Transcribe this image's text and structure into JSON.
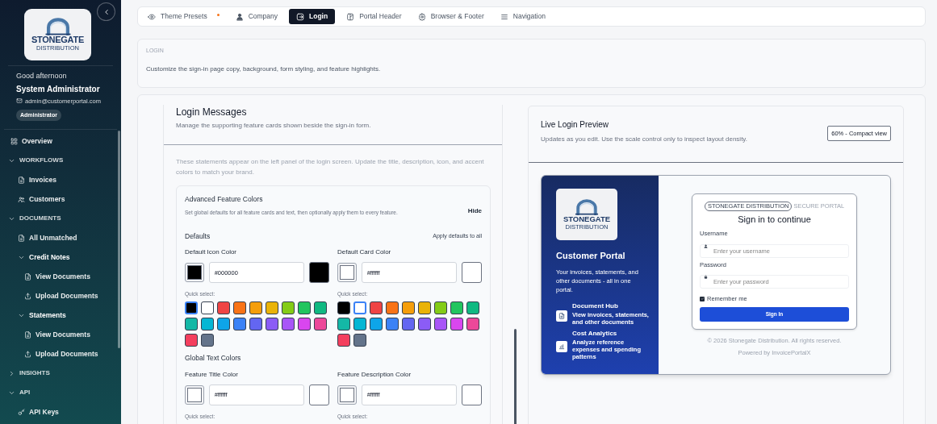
{
  "sidebar": {
    "logo": {
      "name": "STONEGATE",
      "tagline": "DISTRIBUTION"
    },
    "greeting": "Good afternoon",
    "user_name": "System Administrator",
    "email": "admin@customerportal.com",
    "role": "Administrator",
    "nav": [
      {
        "kind": "overview",
        "label": "Overview"
      },
      {
        "kind": "section",
        "label": "WORKFLOWS",
        "expanded": true,
        "children": [
          {
            "kind": "document",
            "label": "Invoices"
          },
          {
            "kind": "customers",
            "label": "Customers"
          }
        ]
      },
      {
        "kind": "section",
        "label": "DOCUMENTS",
        "expanded": true,
        "children": [
          {
            "kind": "document",
            "label": "All Unmatched"
          },
          {
            "kind": "group",
            "label": "Credit Notes",
            "expanded": true,
            "children": [
              {
                "kind": "document",
                "label": "View Documents"
              },
              {
                "kind": "upload",
                "label": "Upload Documents"
              }
            ]
          },
          {
            "kind": "group",
            "label": "Statements",
            "expanded": true,
            "children": [
              {
                "kind": "document",
                "label": "View Documents"
              },
              {
                "kind": "upload",
                "label": "Upload Documents"
              }
            ]
          }
        ]
      },
      {
        "kind": "section",
        "label": "INSIGHTS",
        "expanded": false
      },
      {
        "kind": "section",
        "label": "API",
        "expanded": true,
        "children": [
          {
            "kind": "api-key",
            "label": "API Keys"
          }
        ]
      }
    ]
  },
  "tabs": [
    {
      "label": "Theme Presets",
      "selected": false,
      "modified": true
    },
    {
      "label": "Company",
      "selected": false,
      "modified": false
    },
    {
      "label": "Login",
      "selected": true,
      "modified": false
    },
    {
      "label": "Portal Header",
      "selected": false,
      "modified": false
    },
    {
      "label": "Browser & Footer",
      "selected": false,
      "modified": false
    },
    {
      "label": "Navigation",
      "selected": false,
      "modified": false
    }
  ],
  "section": {
    "eyebrow": "LOGIN",
    "description": "Customize the sign-in page copy, background, form styling, and feature highlights."
  },
  "editor": {
    "title": "Login Messages",
    "subtitle": "Manage the supporting feature cards shown beside the sign-in form.",
    "info": "These statements appear on the left panel of the login screen. Update the title, description, icon, and accent colors to match your brand.",
    "advanced": {
      "title": "Advanced Feature Colors",
      "description": "Set global defaults for all feature cards and text, then optionally apply them to every feature.",
      "toggle": "Hide",
      "groups": [
        {
          "title": "Defaults",
          "action": "Apply defaults to all",
          "fields": [
            {
              "label": "Default Icon Color",
              "value": "#000000",
              "color": "#000000",
              "quick_label": "Quick select:",
              "swatches": [
                {
                  "color": "#000000",
                  "selected": true
                },
                {
                  "color": "#ffffff",
                  "selected": false
                },
                {
                  "color": "#ef4444",
                  "selected": false
                },
                {
                  "color": "#f97316",
                  "selected": false
                },
                {
                  "color": "#f59e0b",
                  "selected": false
                },
                {
                  "color": "#eab308",
                  "selected": false
                },
                {
                  "color": "#84cc16",
                  "selected": false
                },
                {
                  "color": "#22c55e",
                  "selected": false
                },
                {
                  "color": "#10b981",
                  "selected": false
                },
                {
                  "color": "#14b8a6",
                  "selected": false
                },
                {
                  "color": "#06b6d4",
                  "selected": false
                },
                {
                  "color": "#0ea5e9",
                  "selected": false
                },
                {
                  "color": "#3b82f6",
                  "selected": false
                },
                {
                  "color": "#6366f1",
                  "selected": false
                },
                {
                  "color": "#8b5cf6",
                  "selected": false
                },
                {
                  "color": "#a855f7",
                  "selected": false
                },
                {
                  "color": "#d946ef",
                  "selected": false
                },
                {
                  "color": "#ec4899",
                  "selected": false
                },
                {
                  "color": "#f43f5e",
                  "selected": false
                },
                {
                  "color": "#64748b",
                  "selected": false
                }
              ]
            },
            {
              "label": "Default Card Color",
              "value": "#ffffff",
              "color": "#ffffff",
              "quick_label": "Quick select:",
              "swatches": [
                {
                  "color": "#000000",
                  "selected": false
                },
                {
                  "color": "#ffffff",
                  "selected": true
                },
                {
                  "color": "#ef4444",
                  "selected": false
                },
                {
                  "color": "#f97316",
                  "selected": false
                },
                {
                  "color": "#f59e0b",
                  "selected": false
                },
                {
                  "color": "#eab308",
                  "selected": false
                },
                {
                  "color": "#84cc16",
                  "selected": false
                },
                {
                  "color": "#22c55e",
                  "selected": false
                },
                {
                  "color": "#10b981",
                  "selected": false
                },
                {
                  "color": "#14b8a6",
                  "selected": false
                },
                {
                  "color": "#06b6d4",
                  "selected": false
                },
                {
                  "color": "#0ea5e9",
                  "selected": false
                },
                {
                  "color": "#3b82f6",
                  "selected": false
                },
                {
                  "color": "#6366f1",
                  "selected": false
                },
                {
                  "color": "#8b5cf6",
                  "selected": false
                },
                {
                  "color": "#a855f7",
                  "selected": false
                },
                {
                  "color": "#d946ef",
                  "selected": false
                },
                {
                  "color": "#ec4899",
                  "selected": false
                },
                {
                  "color": "#f43f5e",
                  "selected": false
                },
                {
                  "color": "#64748b",
                  "selected": false
                }
              ]
            }
          ]
        },
        {
          "title": "Global Text Colors",
          "fields": [
            {
              "label": "Feature Title Color",
              "value": "#ffffff",
              "color": "#ffffff",
              "quick_label": "Quick select:"
            },
            {
              "label": "Feature Description Color",
              "value": "#ffffff",
              "color": "#ffffff",
              "quick_label": "Quick select:"
            }
          ]
        }
      ]
    }
  },
  "preview": {
    "title": "Live Login Preview",
    "subtitle": "Updates as you edit. Use the scale control only to inspect layout density.",
    "scale": "60% - Compact view",
    "brand_panel": {
      "logo": {
        "name": "STONEGATE",
        "tagline": "DISTRIBUTION"
      },
      "title": "Customer Portal",
      "description": "Your invoices, statements, and other documents - all in one portal.",
      "features": [
        {
          "title": "Document Hub",
          "description": "View invoices, statements, and other documents"
        },
        {
          "title": "Cost Analytics",
          "description": "Analyze reference expenses and spending patterns"
        }
      ]
    },
    "form": {
      "badge": "STONEGATE DISTRIBUTION",
      "badge_note": "SECURE PORTAL",
      "heading": "Sign in to continue",
      "fields": [
        {
          "label": "Username",
          "placeholder": "Enter your username"
        },
        {
          "label": "Password",
          "placeholder": "Enter your password"
        }
      ],
      "remember": {
        "label": "Remember me",
        "checked": true
      },
      "button": "Sign In"
    },
    "footer": "© 2026 Stonegate Distribution. All rights reserved.",
    "powered": "Powered by InvoicePortalX"
  }
}
